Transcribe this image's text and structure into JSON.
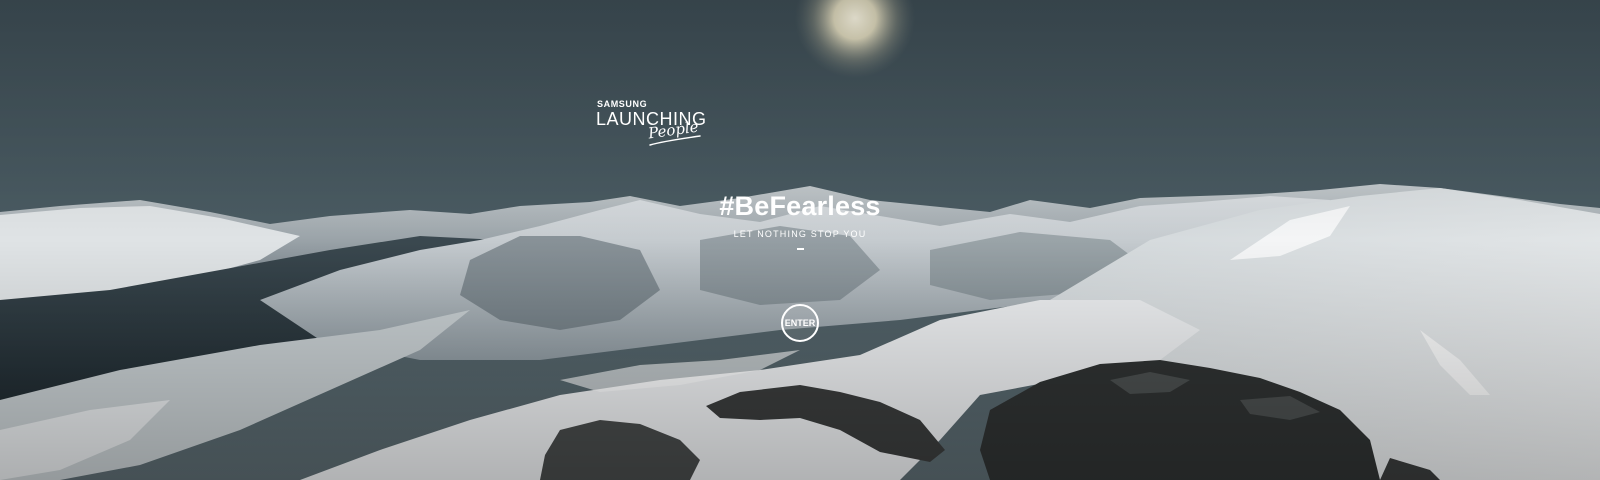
{
  "logo": {
    "brand": "SAMSUNG",
    "main": "LAUNCHING",
    "script": "People"
  },
  "hero": {
    "headline": "#BeFearless",
    "tagline": "LET NOTHING STOP YOU",
    "divider": "–"
  },
  "enter_button": {
    "label": "ENTER"
  },
  "colors": {
    "sky": "#46575f",
    "snow": "#e6e9eb",
    "rock": "#2f3232",
    "text": "#ffffff"
  },
  "icons": {
    "sun": "sun-glow",
    "background": "mountain-panorama"
  }
}
